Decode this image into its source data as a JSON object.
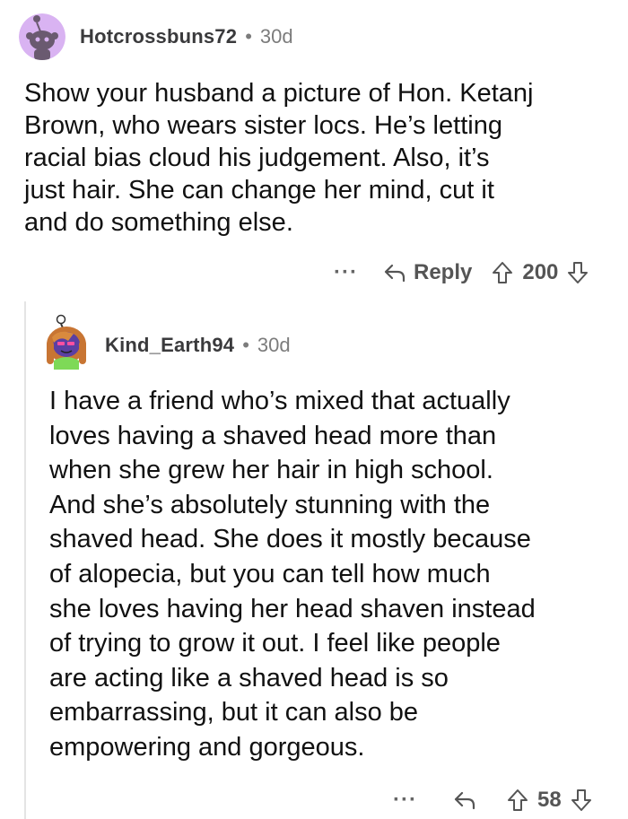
{
  "comments": [
    {
      "username": "Hotcrossbuns72",
      "separator": "•",
      "age": "30d",
      "lines": [
        "Show your husband a picture of Hon. Ketanj",
        "Brown, who wears sister locs. He’s letting",
        "racial bias cloud his judgement. Also, it’s",
        "just hair. She can change her mind, cut it",
        "and do something else."
      ],
      "more": "···",
      "reply_label": "Reply",
      "score": "200",
      "avatar_color": "#d9b3f2"
    },
    {
      "username": "Kind_Earth94",
      "separator": "•",
      "age": "30d",
      "lines": [
        "I have a friend who’s mixed that actually",
        "loves having a shaved head more than",
        "when she grew her hair in high school.",
        "And she’s absolutely stunning with the",
        "shaved head. She does it mostly because",
        "of alopecia, but you can tell how much",
        "she loves having her head shaven instead",
        "of trying to grow it out. I feel like people",
        "are acting like a shaved head is so",
        "embarrassing, but it can also be",
        "empowering and gorgeous."
      ],
      "more": "···",
      "score": "58",
      "avatar_color": "#5b3fa3"
    }
  ],
  "colors": {
    "muted": "#7c7c7c",
    "text": "#111111",
    "thread": "#e4e4e4"
  }
}
